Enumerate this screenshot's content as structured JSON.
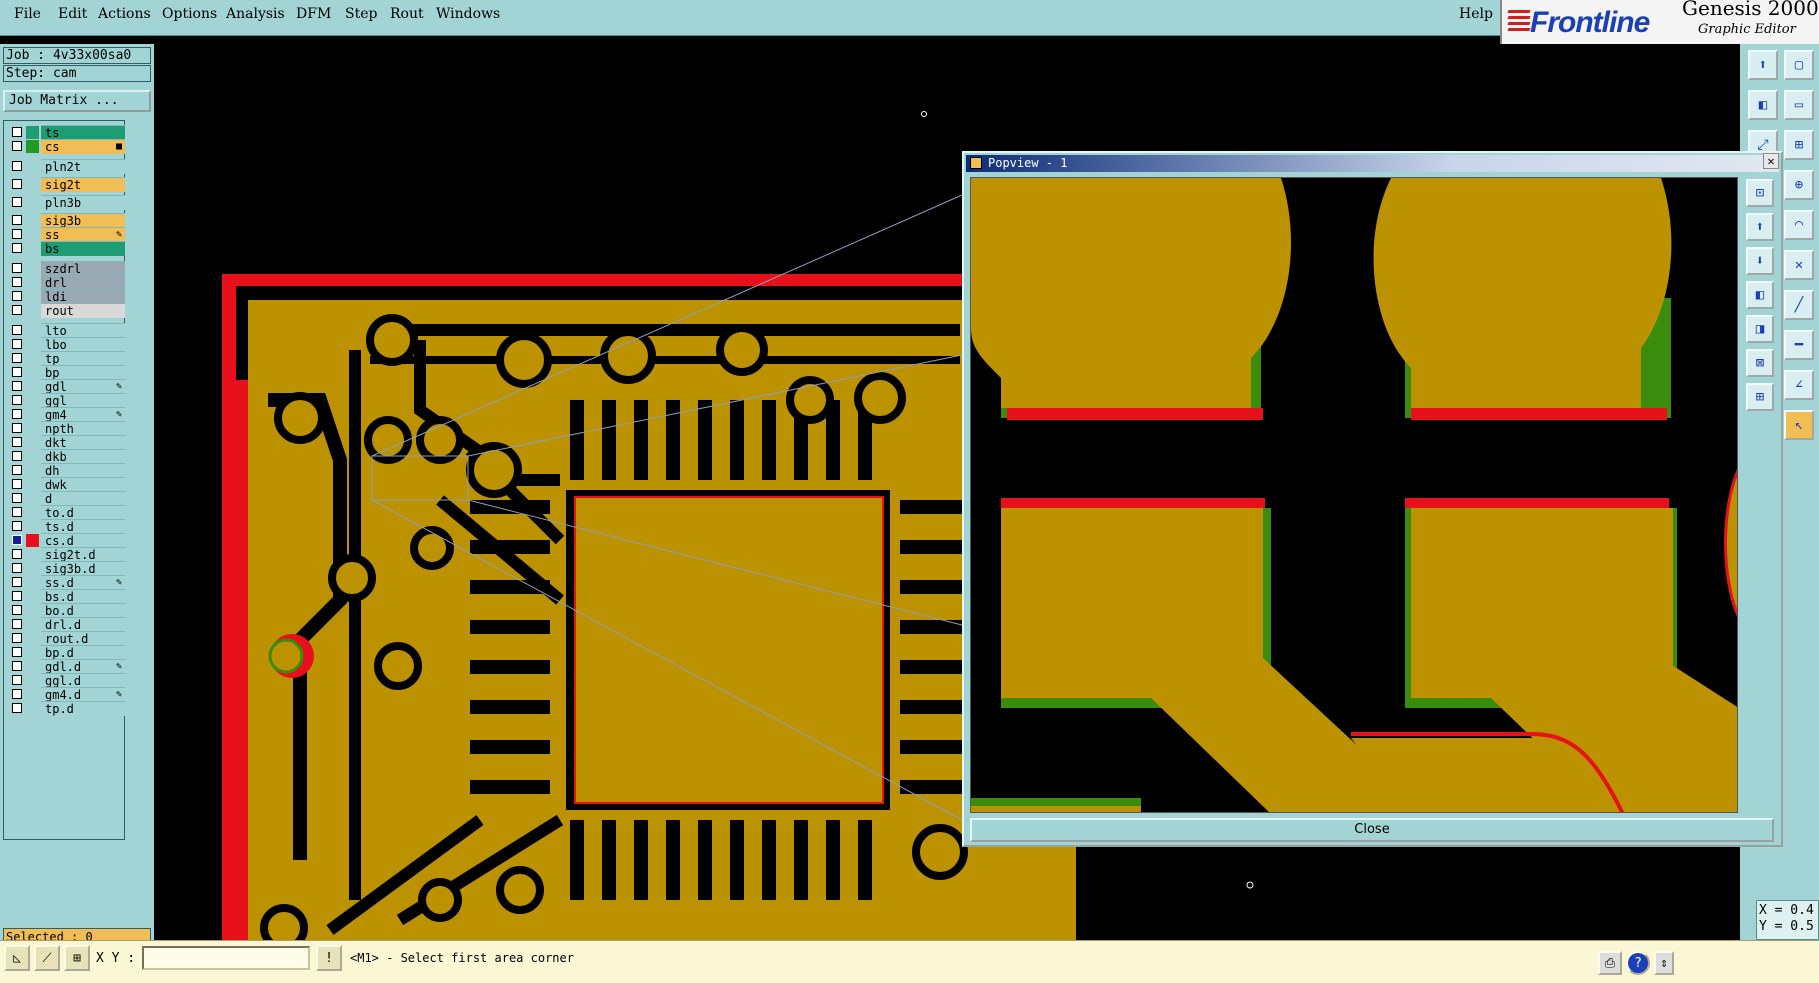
{
  "menu": {
    "items": [
      "File",
      "Edit",
      "Actions",
      "Options",
      "Analysis",
      "DFM",
      "Step",
      "Rout",
      "Windows"
    ],
    "help": "Help"
  },
  "logo": {
    "brand": "Frontline",
    "product": "Genesis 2000",
    "subtitle": "Graphic Editor"
  },
  "job": {
    "job_label": "Job : 4v33x00sa0",
    "step_label": "Step: cam",
    "matrix_button": "Job Matrix ..."
  },
  "layers": [
    {
      "name": "ts",
      "color": "#1e9c74",
      "swatch": "#1e9c74",
      "checked": false
    },
    {
      "name": "cs",
      "color": "#f1bd55",
      "swatch": "#229922",
      "checked": false,
      "mark": "■"
    },
    {
      "name": "pln2t",
      "color": "#a2d4d6",
      "swatch": "",
      "checked": false
    },
    {
      "name": "sig2t",
      "color": "#f1bd55",
      "swatch": "",
      "checked": false
    },
    {
      "name": "pln3b",
      "color": "#a2d4d6",
      "swatch": "",
      "checked": false
    },
    {
      "name": "sig3b",
      "color": "#f1bd55",
      "swatch": "",
      "checked": false
    },
    {
      "name": "ss",
      "color": "#f1bd55",
      "swatch": "",
      "checked": false,
      "mark": "✎"
    },
    {
      "name": "bs",
      "color": "#1e9c74",
      "swatch": "",
      "checked": false
    },
    {
      "name": "szdrl",
      "color": "#9aa8b4",
      "swatch": "",
      "checked": false
    },
    {
      "name": "drl",
      "color": "#9aa8b4",
      "swatch": "",
      "checked": false
    },
    {
      "name": "ldi",
      "color": "#9aa8b4",
      "swatch": "",
      "checked": false
    },
    {
      "name": "rout",
      "color": "#d9d9d9",
      "swatch": "",
      "checked": false
    },
    {
      "name": "lto",
      "color": "#a2d4d6",
      "swatch": "",
      "checked": false
    },
    {
      "name": "lbo",
      "color": "#a2d4d6",
      "swatch": "",
      "checked": false
    },
    {
      "name": "tp",
      "color": "#a2d4d6",
      "swatch": "",
      "checked": false
    },
    {
      "name": "bp",
      "color": "#a2d4d6",
      "swatch": "",
      "checked": false
    },
    {
      "name": "gdl",
      "color": "#a2d4d6",
      "swatch": "",
      "checked": false,
      "mark": "✎"
    },
    {
      "name": "ggl",
      "color": "#a2d4d6",
      "swatch": "",
      "checked": false
    },
    {
      "name": "gm4",
      "color": "#a2d4d6",
      "swatch": "",
      "checked": false,
      "mark": "✎"
    },
    {
      "name": "npth",
      "color": "#a2d4d6",
      "swatch": "",
      "checked": false
    },
    {
      "name": "dkt",
      "color": "#a2d4d6",
      "swatch": "",
      "checked": false
    },
    {
      "name": "dkb",
      "color": "#a2d4d6",
      "swatch": "",
      "checked": false
    },
    {
      "name": "dh",
      "color": "#a2d4d6",
      "swatch": "",
      "checked": false
    },
    {
      "name": "dwk",
      "color": "#a2d4d6",
      "swatch": "",
      "checked": false
    },
    {
      "name": "d",
      "color": "#a2d4d6",
      "swatch": "",
      "checked": false
    },
    {
      "name": "to.d",
      "color": "#a2d4d6",
      "swatch": "",
      "checked": false
    },
    {
      "name": "ts.d",
      "color": "#a2d4d6",
      "swatch": "",
      "checked": false
    },
    {
      "name": "cs.d",
      "color": "#a2d4d6",
      "swatch": "#e8111b",
      "checked": true
    },
    {
      "name": "sig2t.d",
      "color": "#a2d4d6",
      "swatch": "",
      "checked": false
    },
    {
      "name": "sig3b.d",
      "color": "#a2d4d6",
      "swatch": "",
      "checked": false
    },
    {
      "name": "ss.d",
      "color": "#a2d4d6",
      "swatch": "",
      "checked": false,
      "mark": "✎"
    },
    {
      "name": "bs.d",
      "color": "#a2d4d6",
      "swatch": "",
      "checked": false
    },
    {
      "name": "bo.d",
      "color": "#a2d4d6",
      "swatch": "",
      "checked": false
    },
    {
      "name": "drl.d",
      "color": "#a2d4d6",
      "swatch": "",
      "checked": false
    },
    {
      "name": "rout.d",
      "color": "#a2d4d6",
      "swatch": "",
      "checked": false
    },
    {
      "name": "bp.d",
      "color": "#a2d4d6",
      "swatch": "",
      "checked": false
    },
    {
      "name": "gdl.d",
      "color": "#a2d4d6",
      "swatch": "",
      "checked": false,
      "mark": "✎"
    },
    {
      "name": "ggl.d",
      "color": "#a2d4d6",
      "swatch": "",
      "checked": false
    },
    {
      "name": "gm4.d",
      "color": "#a2d4d6",
      "swatch": "",
      "checked": false,
      "mark": "✎"
    },
    {
      "name": "tp.d",
      "color": "#a2d4d6",
      "swatch": "",
      "checked": false
    }
  ],
  "status": {
    "selected": "Selected : 0"
  },
  "coords": {
    "x": "X = 0.4",
    "y": "Y = 0.5"
  },
  "bottom": {
    "xy_label": "X Y :",
    "xy_value": "",
    "prompt": "<M1> - Select first area corner"
  },
  "popview": {
    "title": "Popview - 1",
    "close_x": "✕",
    "close_button": "Close"
  },
  "colors": {
    "copper": "#bc9200",
    "drill": "#e8111b",
    "mask": "#3a8c0c",
    "panel": "#a2d4d6",
    "statusbar": "#fbf6d3"
  },
  "icons": {
    "right_toolbar": [
      "top-view-icon",
      "panel-icon",
      "left-view-icon",
      "rect-icon",
      "fit-icon",
      "grid-icon",
      "zoom-icon",
      "arc-icon",
      "snap-icon",
      "line-icon",
      "measure-icon",
      "angle-icon",
      "pointer-icon"
    ],
    "popview_toolbar": [
      "fit-screen-icon",
      "zoom-in-icon",
      "zoom-out-icon",
      "pan-left-icon",
      "pan-right-icon",
      "zoom-area-icon",
      "zoom-home-icon"
    ],
    "bottom_toolbar": [
      "select-tool-icon",
      "cross-tool-icon",
      "grid-tool-icon",
      "info-icon",
      "print-icon",
      "help-icon",
      "menu-icon"
    ]
  }
}
